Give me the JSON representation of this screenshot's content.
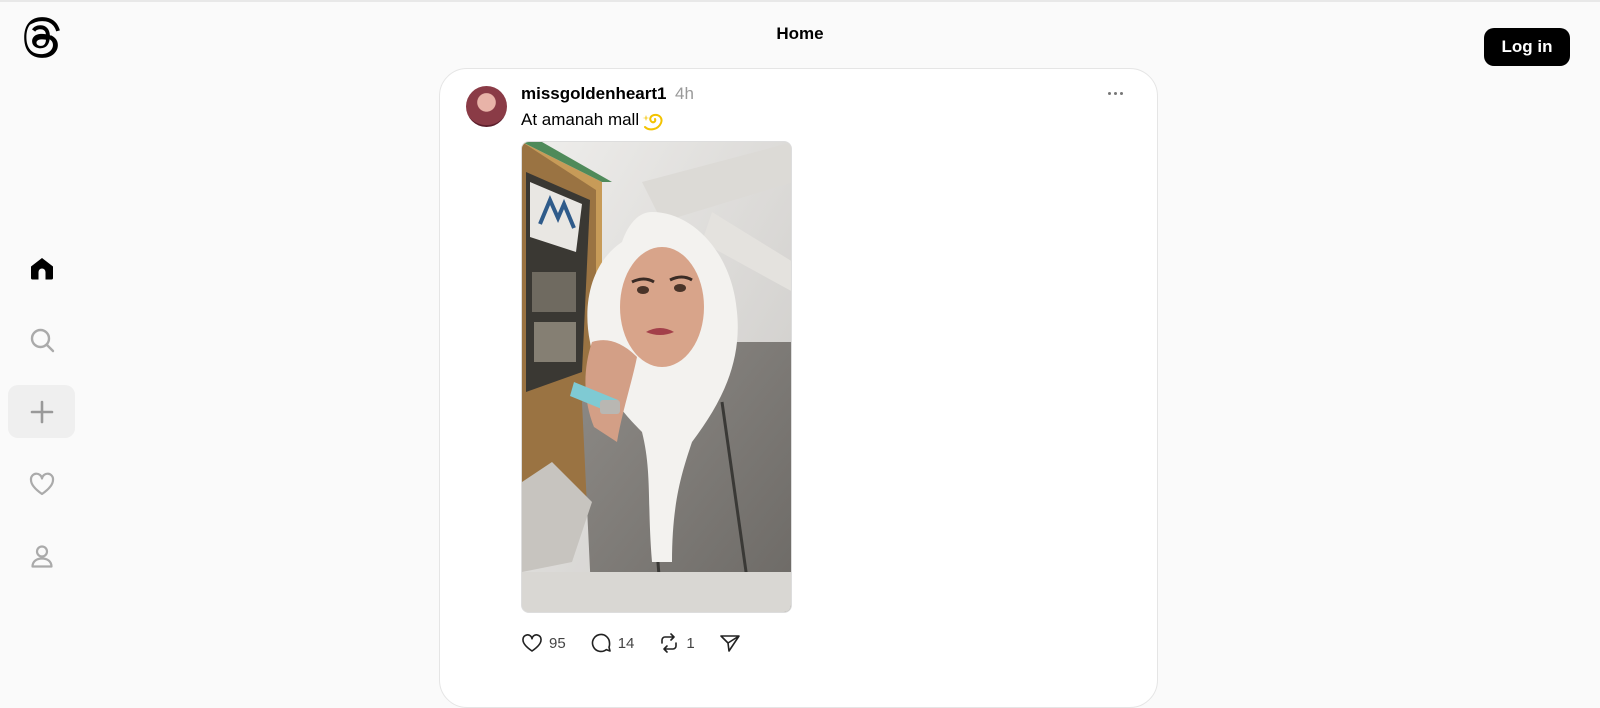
{
  "header": {
    "title": "Home",
    "login_label": "Log in"
  },
  "sidebar": {
    "items": [
      {
        "icon": "home-icon"
      },
      {
        "icon": "search-icon"
      },
      {
        "icon": "plus-icon"
      },
      {
        "icon": "heart-icon"
      },
      {
        "icon": "profile-icon"
      }
    ]
  },
  "post": {
    "username": "missgoldenheart1",
    "time": "4h",
    "text": "At amanah mall",
    "emoji": "dizzy-icon",
    "actions": {
      "likes": "95",
      "comments": "14",
      "reposts": "1"
    }
  },
  "colors": {
    "background": "#fafafa",
    "card": "#ffffff",
    "button": "#000000",
    "muted": "#999999"
  }
}
